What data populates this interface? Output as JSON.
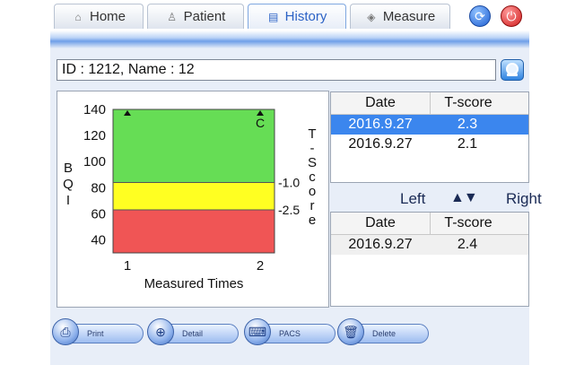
{
  "tabs": [
    {
      "label": "Home",
      "icon": "home-icon"
    },
    {
      "label": "Patient",
      "icon": "patient-icon"
    },
    {
      "label": "History",
      "icon": "history-icon",
      "active": true
    },
    {
      "label": "Measure",
      "icon": "measure-icon"
    }
  ],
  "patient": {
    "id_line": "ID : 1212, Name : 12"
  },
  "chart_data": {
    "type": "scatter",
    "ylabel": "BQI",
    "xlabel": "Measured Times",
    "y2label": "T-Score",
    "yticks": [
      140,
      120,
      100,
      80,
      60,
      40
    ],
    "xticks": [
      1,
      2
    ],
    "ylim": [
      30,
      140
    ],
    "xlim": [
      1,
      2
    ],
    "thresholds": [
      {
        "label": "-1.0",
        "value": 84
      },
      {
        "label": "-2.5",
        "value": 63
      }
    ],
    "bands": {
      "high": "#66dd55",
      "mid": "#ffff22",
      "low": "#f05555"
    },
    "points": [
      {
        "x": 1,
        "y": 140,
        "label": ""
      },
      {
        "x": 2,
        "y": 140,
        "label": "C"
      }
    ]
  },
  "table_top": {
    "headers": [
      "Date",
      "T-score"
    ],
    "rows": [
      {
        "date": "2016.9.27",
        "tscore": "2.3",
        "selected": true
      },
      {
        "date": "2016.9.27",
        "tscore": "2.1"
      }
    ]
  },
  "side_toggle": {
    "left": "Left",
    "right": "Right",
    "arrows": "▲▼"
  },
  "table_bottom": {
    "headers": [
      "Date",
      "T-score"
    ],
    "rows": [
      {
        "date": "2016.9.27",
        "tscore": "2.4"
      }
    ]
  },
  "buttons": {
    "print": "Print",
    "detail": "Detail",
    "pacs": "PACS",
    "delete": "Delete"
  },
  "colors": {
    "accent": "#2b62c5",
    "selected_row": "#3b86ee"
  }
}
